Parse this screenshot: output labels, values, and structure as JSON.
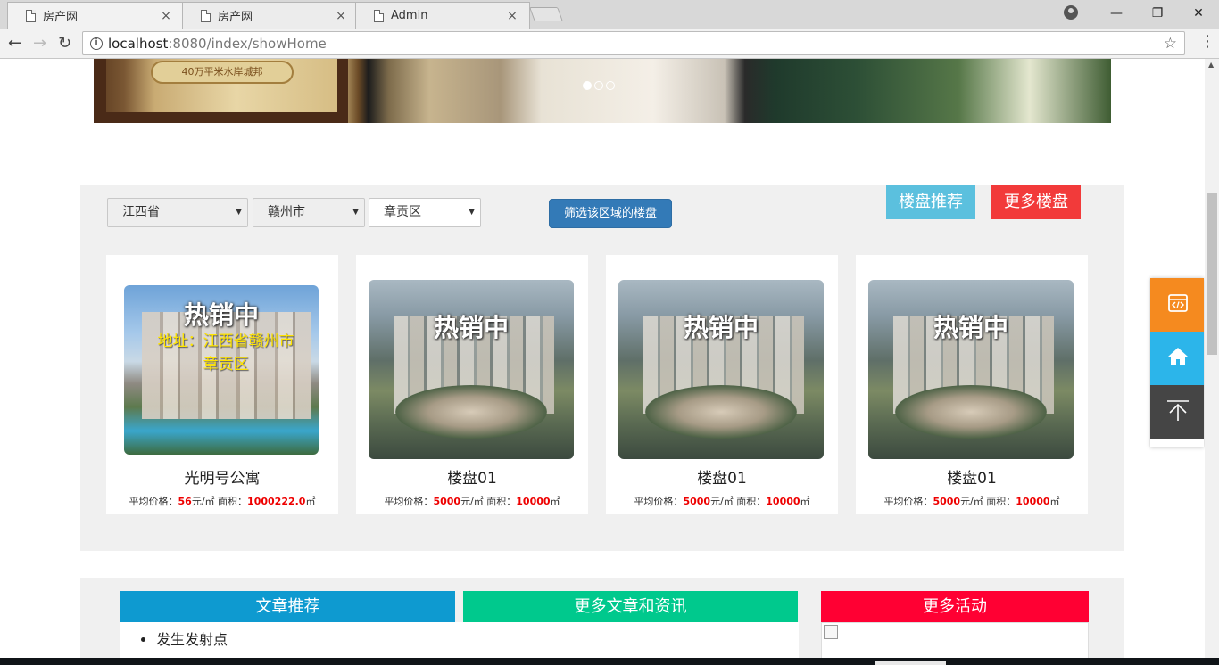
{
  "browser": {
    "tabs": [
      {
        "title": "房产网",
        "close": "×",
        "active": true
      },
      {
        "title": "房产网",
        "close": "×",
        "active": false
      },
      {
        "title": "Admin",
        "close": "×",
        "active": false
      }
    ],
    "url_host": "localhost",
    "url_rest": ":8080/index/showHome",
    "window_controls": {
      "minimize": "—",
      "restore": "❐",
      "close": "✕"
    }
  },
  "banner": {
    "sign_text": "40万平米水岸城邦",
    "carousel_active": 1,
    "carousel_count": 3
  },
  "filters": {
    "province": "江西省",
    "city": "赣州市",
    "district": "章贡区",
    "filter_button": "筛选该区域的楼盘",
    "recommend_button": "楼盘推荐",
    "more_button": "更多楼盘"
  },
  "houses": [
    {
      "overlay": "热销中",
      "address": "地址：江西省赣州市章贡区",
      "name": "光明号公寓",
      "price_label": "平均价格：",
      "price": "56",
      "price_unit": "元/㎡ 面积：",
      "area": "1000222.0",
      "area_unit": "㎡"
    },
    {
      "overlay": "热销中",
      "address": "",
      "name": "楼盘01",
      "price_label": "平均价格：",
      "price": "5000",
      "price_unit": "元/㎡ 面积：",
      "area": "10000",
      "area_unit": "㎡"
    },
    {
      "overlay": "热销中",
      "address": "",
      "name": "楼盘01",
      "price_label": "平均价格：",
      "price": "5000",
      "price_unit": "元/㎡ 面积：",
      "area": "10000",
      "area_unit": "㎡"
    },
    {
      "overlay": "热销中",
      "address": "",
      "name": "楼盘01",
      "price_label": "平均价格：",
      "price": "5000",
      "price_unit": "元/㎡ 面积：",
      "area": "10000",
      "area_unit": "㎡"
    }
  ],
  "articles": {
    "recommend_header": "文章推荐",
    "more_header": "更多文章和资讯",
    "activity_header": "更多活动",
    "items": [
      "发生发射点"
    ]
  },
  "colors": {
    "filter_button": "#337ab7",
    "recommend": "#5bc0de",
    "more": "#f23a3a",
    "article_header": "#0e9ad0",
    "more_article_header": "#00c98d",
    "activity_header": "#ff0033",
    "float_orange": "#f58a1f",
    "float_blue": "#2cb5ea",
    "float_dark": "#454545"
  },
  "float_bar": [
    "code-icon",
    "home-icon",
    "back-to-top-icon"
  ]
}
